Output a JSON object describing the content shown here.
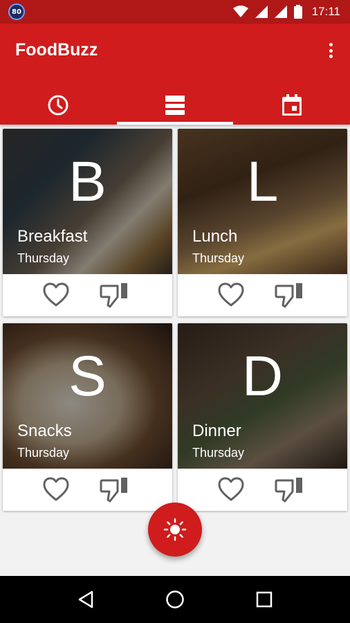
{
  "status_bar": {
    "badge": "80",
    "time": "17:11",
    "icons": [
      "wifi-icon",
      "signal-icon",
      "signal-icon",
      "battery-icon"
    ]
  },
  "app_bar": {
    "title": "FoodBuzz",
    "overflow_icon": "more-vert-icon",
    "tabs": [
      {
        "icon": "clock-icon",
        "active": false
      },
      {
        "icon": "view-list-icon",
        "active": true
      },
      {
        "icon": "calendar-icon",
        "active": false
      }
    ]
  },
  "meals": [
    {
      "letter": "B",
      "title": "Breakfast",
      "day": "Thursday"
    },
    {
      "letter": "L",
      "title": "Lunch",
      "day": "Thursday"
    },
    {
      "letter": "S",
      "title": "Snacks",
      "day": "Thursday"
    },
    {
      "letter": "D",
      "title": "Dinner",
      "day": "Thursday"
    }
  ],
  "fab": {
    "icon": "brightness-icon"
  },
  "colors": {
    "primary": "#d01c1c",
    "status_bar": "#b01818",
    "background": "#f2f2f2",
    "icon_gray": "#616161"
  },
  "nav": {
    "back_icon": "back-icon",
    "home_icon": "home-icon",
    "recents_icon": "recents-icon"
  }
}
